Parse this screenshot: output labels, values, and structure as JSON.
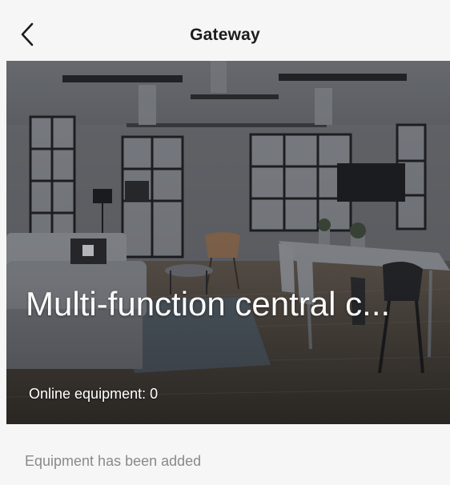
{
  "nav": {
    "title": "Gateway"
  },
  "hero": {
    "device_name": "Multi-function central c...",
    "online_label": "Online equipment: ",
    "online_count": "0"
  },
  "section": {
    "added_label": "Equipment has been added"
  },
  "icons": {
    "back": "chevron-left-icon"
  }
}
